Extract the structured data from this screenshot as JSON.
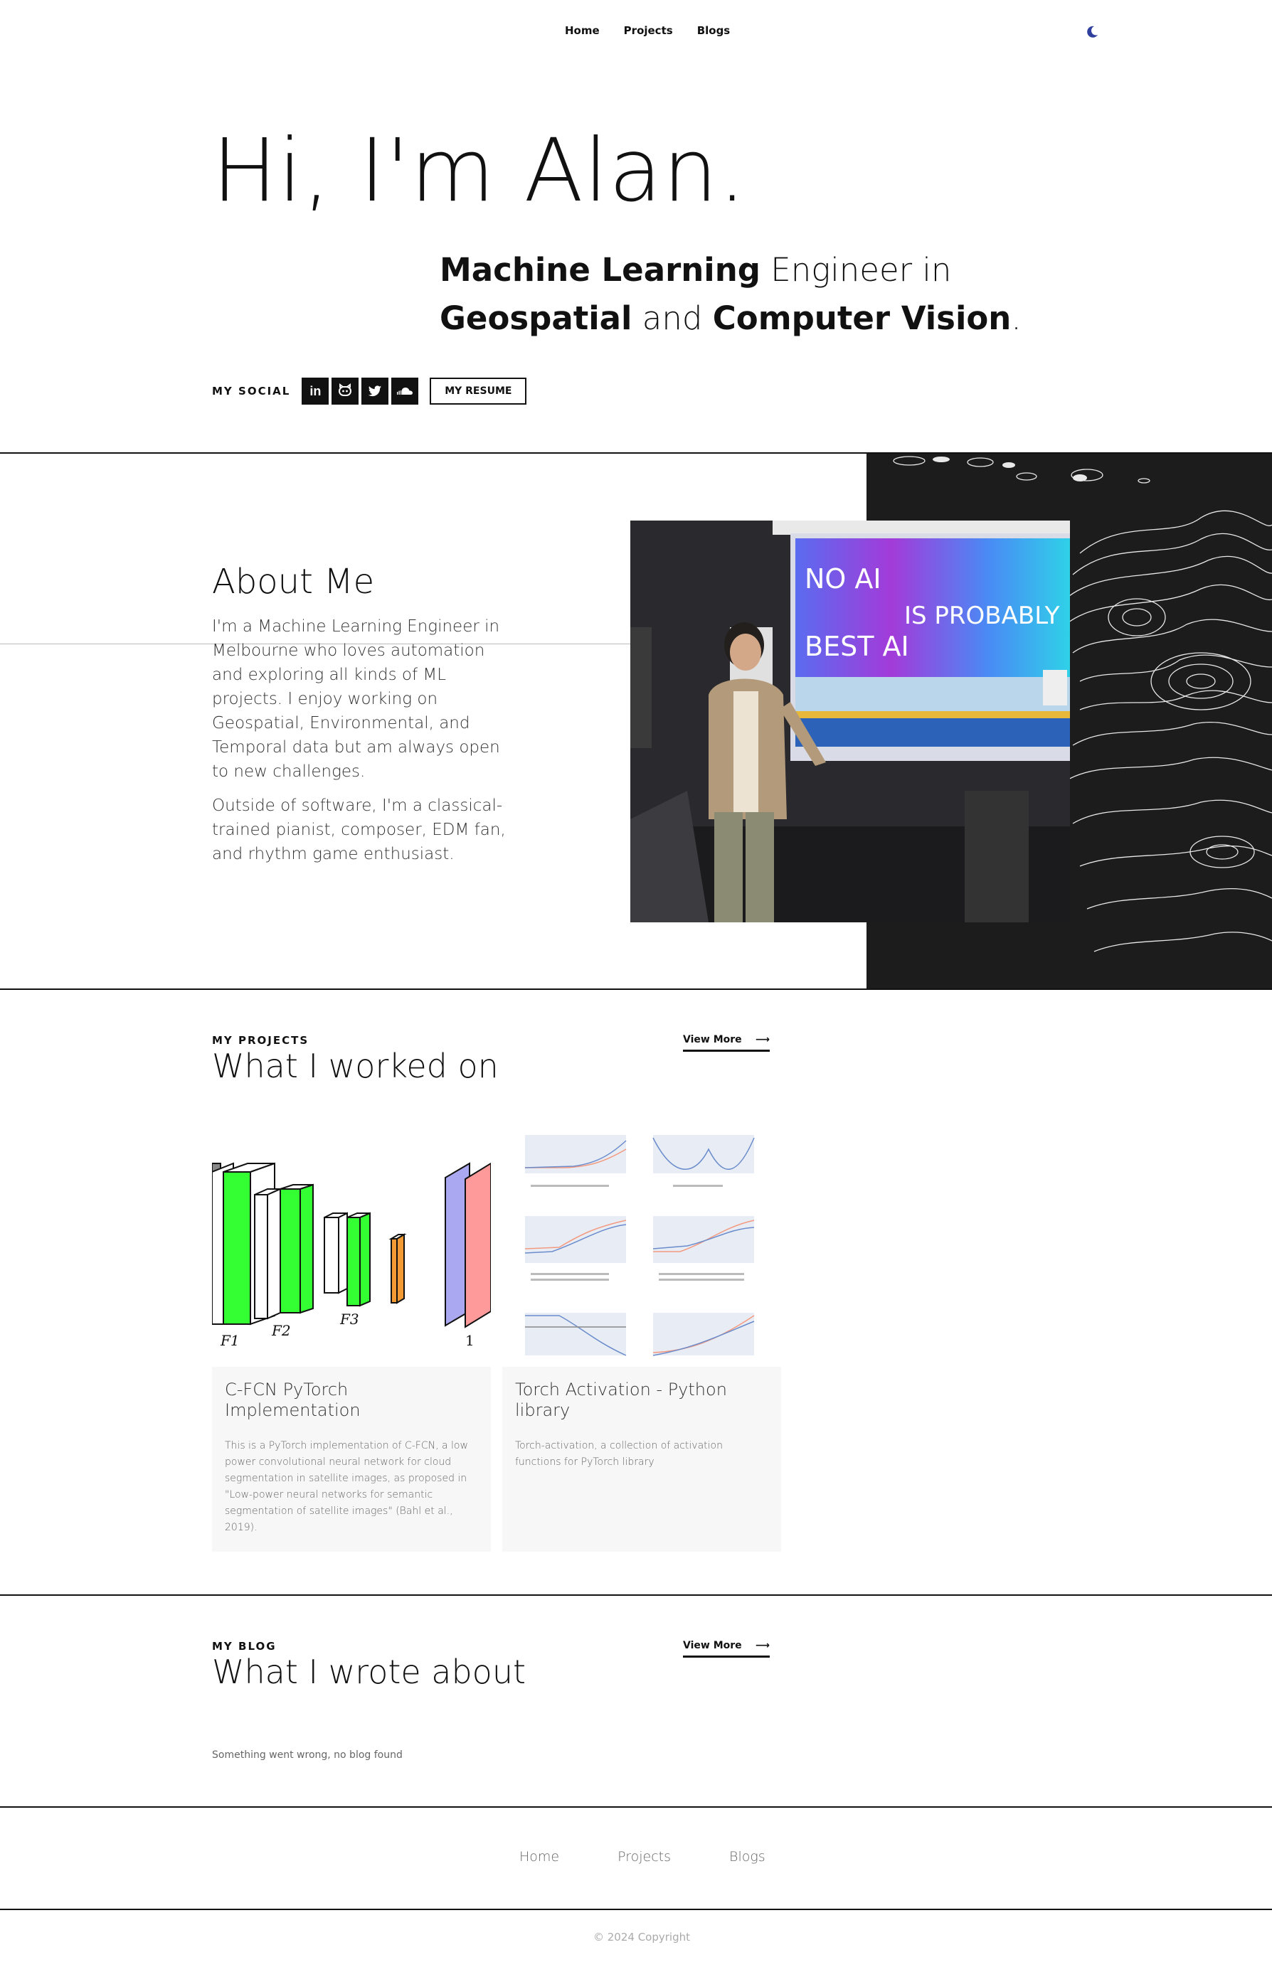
{
  "nav": {
    "items": [
      "Home",
      "Projects",
      "Blogs"
    ],
    "theme_icon": "moon-icon"
  },
  "hero": {
    "greeting": "Hi, I'm Alan.",
    "sub": {
      "b1": "Machine Learning",
      "t1": " Engineer in",
      "b2": "Geospatial",
      "t2": " and ",
      "b3": "Computer Vision",
      "t3": "."
    },
    "social_label": "MY SOCIAL",
    "social_icons": [
      "linkedin-icon",
      "github-icon",
      "twitter-icon",
      "soundcloud-icon"
    ],
    "resume_label": "MY RESUME"
  },
  "about": {
    "title": "About Me",
    "p1": "I'm a Machine Learning Engineer in Melbourne who loves automation and exploring all kinds of ML projects. I enjoy working on Geospatial, Environmental, and Temporal data but am always open to new challenges.",
    "p2": "Outside of software, I'm a classical-trained pianist, composer, EDM fan, and rhythm game enthusiast.",
    "slide": {
      "line1": "NO AI",
      "line2": "IS PROBABLY",
      "line3": "BEST AI"
    }
  },
  "projects": {
    "label": "MY PROJECTS",
    "title": "What I worked on",
    "view_more": "View More",
    "cards": [
      {
        "title": "C-FCN PyTorch Implementation",
        "desc": "This is a PyTorch implementation of C-FCN, a low power convolutional neural network for cloud segmentation in satellite images, as proposed in \"Low-power neural networks for semantic segmentation of satellite images\" (Bahl et al., 2019).",
        "fig_labels": [
          "F1",
          "F2",
          "F3",
          "1"
        ]
      },
      {
        "title": "Torch Activation - Python library",
        "desc": "Torch-activation, a collection of activation functions for PyTorch library"
      }
    ]
  },
  "blog": {
    "label": "MY BLOG",
    "title": "What I wrote about",
    "view_more": "View More",
    "empty_message": "Something went wrong, no blog found"
  },
  "footer": {
    "links": [
      "Home",
      "Projects",
      "Blogs"
    ],
    "copyright": "© 2024 Copyright"
  },
  "colors": {
    "accent_moon": "#2f3f9e",
    "dark_panel": "#1c1c1c",
    "card_bg": "#f7f7f7",
    "cnn_green": "#33ff33",
    "cnn_orange": "#f39a35",
    "cnn_violet": "#aaa8f0",
    "cnn_pink": "#ff9a9a"
  }
}
